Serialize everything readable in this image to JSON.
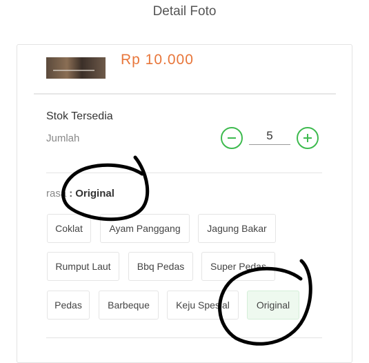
{
  "header": {
    "title": "Detail Foto"
  },
  "product": {
    "price": "Rp 10.000"
  },
  "stock": {
    "title": "Stok Tersedia",
    "quantity_label": "Jumlah",
    "quantity": "5"
  },
  "variant": {
    "label": "rasa",
    "separator": ":",
    "selected": "Original",
    "options": [
      "Coklat",
      "Ayam Panggang",
      "Jagung Bakar",
      "Rumput Laut",
      "Bbq Pedas",
      "Super Pedas",
      "Pedas",
      "Barbeque",
      "Keju Spesial",
      "Original"
    ]
  },
  "colors": {
    "accent": "#3dba4e",
    "price": "#e8763a",
    "selected_bg": "#eef9ef"
  },
  "icons": {
    "minus": "minus-circle-icon",
    "plus": "plus-circle-icon"
  }
}
